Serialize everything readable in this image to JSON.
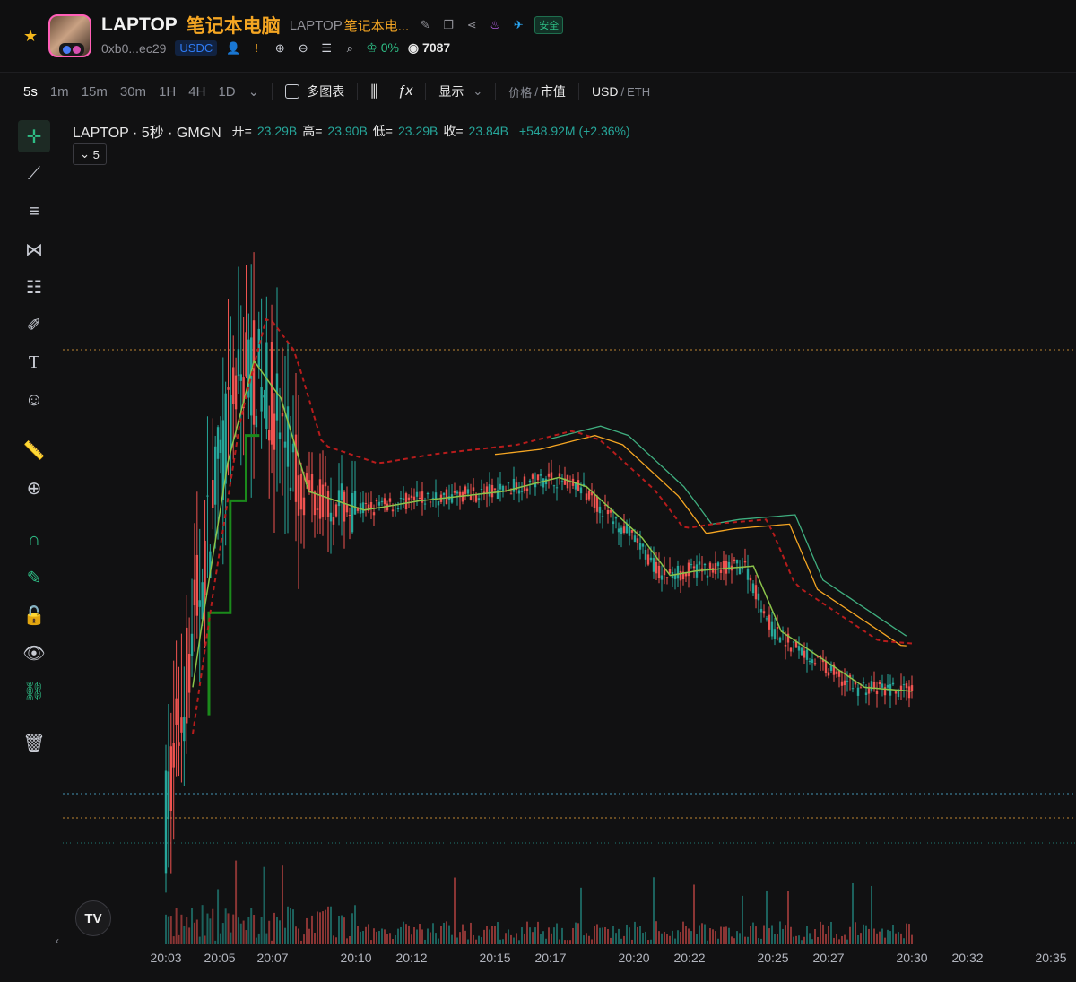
{
  "header": {
    "symbol": "LAPTOP",
    "name_cn": "笔记本电脑",
    "sub_symbol": "LAPTOP",
    "sub_name": "笔记本电...",
    "safety_badge": "安全",
    "address": "0xb0...ec29",
    "quote_token": "USDC",
    "tax_pct": "0%",
    "views": "7087"
  },
  "toolbar": {
    "timeframes": [
      "5s",
      "1m",
      "15m",
      "30m",
      "1H",
      "4H",
      "1D"
    ],
    "active_timeframe": "5s",
    "multi_chart": "多图表",
    "display": "显示",
    "price_label": "价格",
    "slash": "/",
    "mcap_label": "市值",
    "usd_label": "USD",
    "eth_label": "ETH"
  },
  "legend": {
    "title": "LAPTOP · 5秒 · GMGN",
    "open_label": "开=",
    "open": "23.29B",
    "high_label": "高=",
    "high": "23.90B",
    "low_label": "低=",
    "low": "23.29B",
    "close_label": "收=",
    "close": "23.84B",
    "change": "+548.92M (+2.36%)",
    "collapse_count": "5"
  },
  "colors": {
    "up": "#26a69a",
    "down": "#ef5350",
    "accent_orange": "#f5a623",
    "ma_light_green": "#8bc34a",
    "ma_dark_green": "#1b8a1b",
    "ma_red_dashed": "#b71c1c"
  },
  "icons": [
    "star-icon",
    "edit-icon",
    "copy-icon",
    "share-icon",
    "fire-icon",
    "telegram-icon",
    "user-icon",
    "warning-icon",
    "globe-icon",
    "minus-circle-icon",
    "notes-icon",
    "search-icon",
    "chef-icon",
    "eye-icon",
    "candles-icon",
    "fx-icon",
    "chevron-down-icon",
    "crosshair-icon",
    "trendline-icon",
    "horizontal-lines-icon",
    "pattern-icon",
    "fib-icon",
    "brush-icon",
    "text-icon",
    "emoji-icon",
    "ruler-icon",
    "zoom-icon",
    "magnet-icon",
    "lock-pencil-icon",
    "unlock-icon",
    "eye-tool-icon",
    "link-icon",
    "trash-icon"
  ],
  "chart_data": {
    "type": "candlestick",
    "interval": "5s",
    "x_ticks": [
      "20:03",
      "20:05",
      "20:07",
      "20:10",
      "20:12",
      "20:15",
      "20:17",
      "20:20",
      "20:22",
      "20:25",
      "20:27",
      "20:30",
      "20:32",
      "20:35"
    ],
    "price_trend_B": [
      {
        "t": "20:03",
        "v": 20.5
      },
      {
        "t": "20:04",
        "v": 22.5
      },
      {
        "t": "20:05",
        "v": 24.3
      },
      {
        "t": "20:06",
        "v": 25.4
      },
      {
        "t": "20:07",
        "v": 25.0
      },
      {
        "t": "20:08",
        "v": 24.0
      },
      {
        "t": "20:09",
        "v": 23.9
      },
      {
        "t": "20:10",
        "v": 23.8
      },
      {
        "t": "20:12",
        "v": 23.9
      },
      {
        "t": "20:15",
        "v": 24.0
      },
      {
        "t": "20:17",
        "v": 24.15
      },
      {
        "t": "20:18",
        "v": 24.05
      },
      {
        "t": "20:20",
        "v": 23.5
      },
      {
        "t": "20:21",
        "v": 23.1
      },
      {
        "t": "20:22",
        "v": 23.15
      },
      {
        "t": "20:24",
        "v": 23.2
      },
      {
        "t": "20:25",
        "v": 22.5
      },
      {
        "t": "20:26",
        "v": 22.3
      },
      {
        "t": "20:28",
        "v": 21.9
      },
      {
        "t": "20:30",
        "v": 21.85
      }
    ],
    "last": {
      "open": "23.29B",
      "high": "23.90B",
      "low": "23.29B",
      "close": "23.84B",
      "change": "+548.92M (+2.36%)"
    }
  }
}
